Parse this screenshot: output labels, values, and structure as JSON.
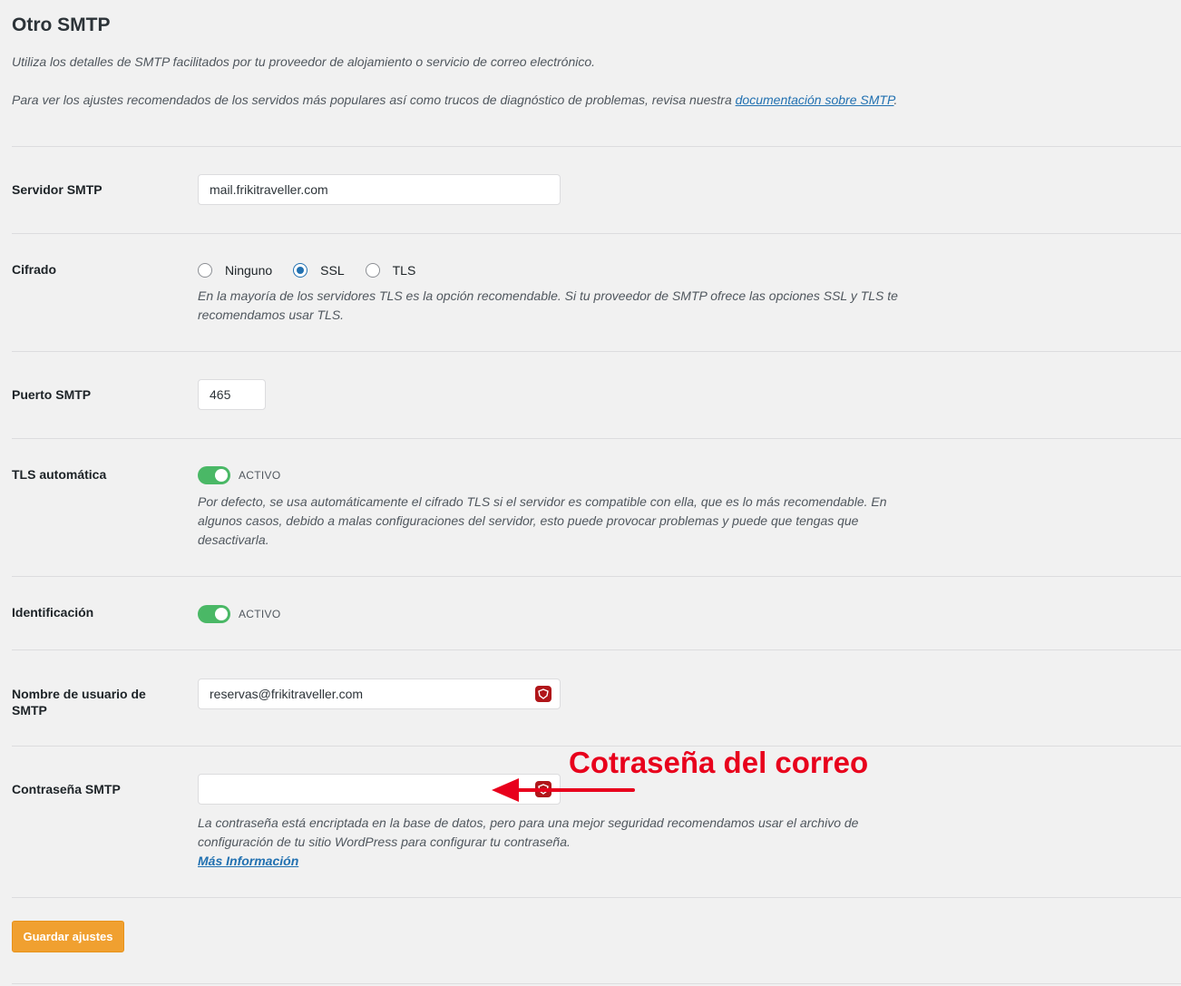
{
  "section": {
    "title": "Otro SMTP",
    "intro_1": "Utiliza los detalles de SMTP facilitados por tu proveedor de alojamiento o servicio de correo electrónico.",
    "intro_2_text": "Para ver los ajustes recomendados de los servidos más populares así como trucos de diagnóstico de problemas, revisa nuestra ",
    "intro_2_link": "documentación sobre SMTP",
    "intro_2_end": "."
  },
  "fields": {
    "smtp_server": {
      "label": "Servidor SMTP",
      "value": "mail.frikitraveller.com"
    },
    "encryption": {
      "label": "Cifrado",
      "options": [
        "Ninguno",
        "SSL",
        "TLS"
      ],
      "selected": "SSL",
      "description": "En la mayoría de los servidores TLS es la opción recomendable. Si tu proveedor de SMTP ofrece las opciones SSL y TLS te recomendamos usar TLS."
    },
    "smtp_port": {
      "label": "Puerto SMTP",
      "value": "465"
    },
    "auto_tls": {
      "label": "TLS automática",
      "state": "ACTIVO",
      "description": "Por defecto, se usa automáticamente el cifrado TLS si el servidor es compatible con ella, que es lo más recomendable. En algunos casos, debido a malas configuraciones del servidor, esto puede provocar problemas y puede que tengas que desactivarla."
    },
    "authentication": {
      "label": "Identificación",
      "state": "ACTIVO"
    },
    "smtp_username": {
      "label": "Nombre de usuario de SMTP",
      "value": "reservas@frikitraveller.com"
    },
    "smtp_password": {
      "label": "Contraseña SMTP",
      "value": "",
      "description": "La contraseña está encriptada en la base de datos, pero para una mejor seguridad recomendamos usar el archivo de configuración de tu sitio WordPress para configurar tu contraseña.",
      "more_link": "Más Información"
    }
  },
  "annotation": {
    "text": "Cotraseña del correo",
    "color": "#e8001c"
  },
  "save_button": {
    "label": "Guardar ajustes"
  },
  "colors": {
    "accent": "#2271b1",
    "toggle_on": "#4ab866",
    "save": "#f0a030",
    "password_manager": "#b0161a"
  },
  "icons": {
    "password_manager": "lastpass-icon"
  }
}
